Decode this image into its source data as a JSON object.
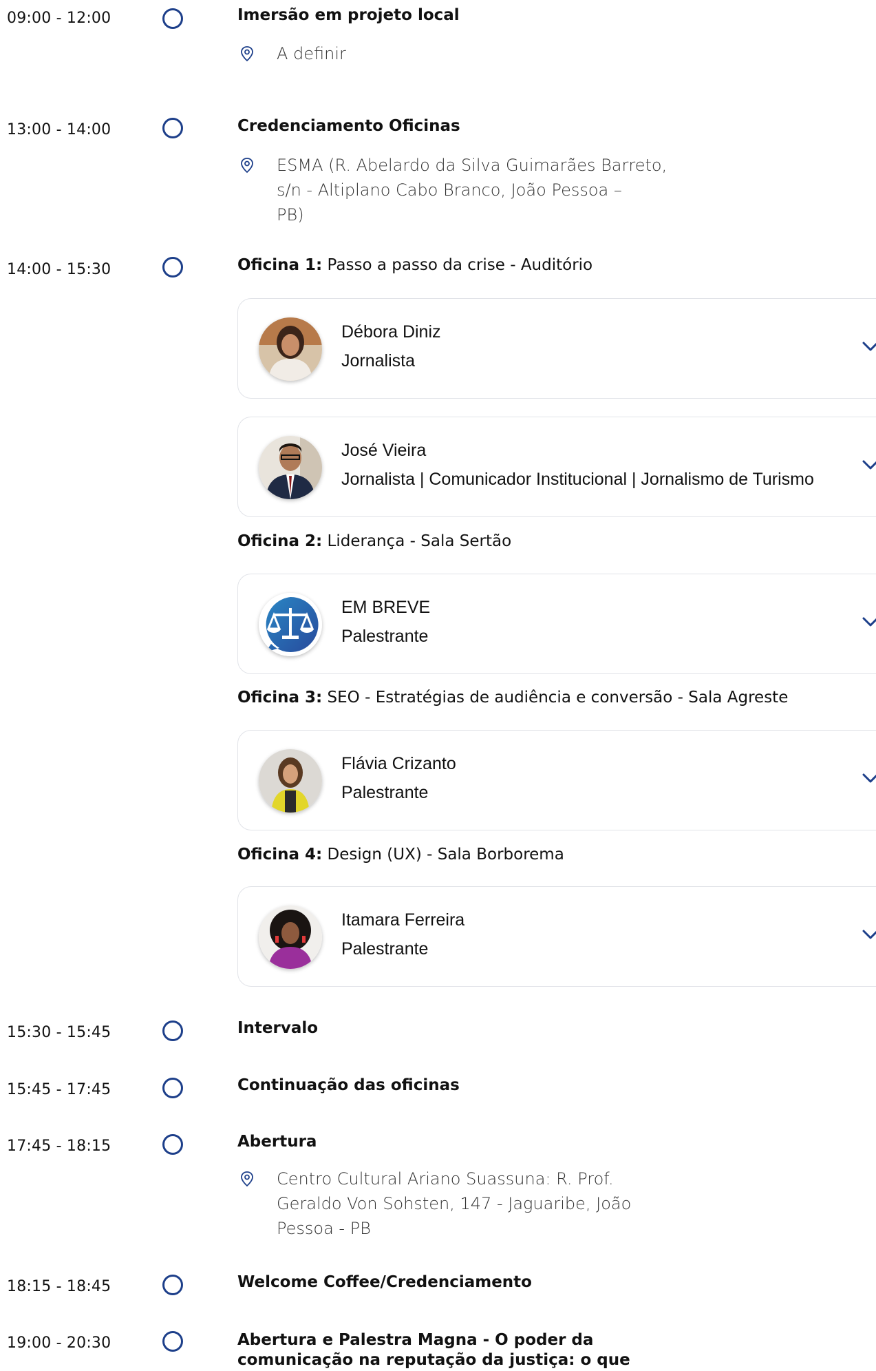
{
  "colors": {
    "accent": "#1d3f8a"
  },
  "schedule": [
    {
      "time": "09:00 - 12:00",
      "title": "Imersão em projeto local",
      "location": "A definir"
    },
    {
      "time": "13:00 - 14:00",
      "title": "Credenciamento Oficinas",
      "location_lines": [
        "ESMA (R. Abelardo da Silva Guimarães Barreto,",
        "s/n - Altiplano Cabo Branco, João Pessoa –",
        "PB)"
      ]
    },
    {
      "time": "14:00 - 15:30"
    },
    {
      "time": "15:30 - 15:45",
      "title": "Intervalo"
    },
    {
      "time": "15:45 - 17:45",
      "title": "Continuação das oficinas"
    },
    {
      "time": "17:45 - 18:15",
      "title": "Abertura",
      "location_lines": [
        "Centro Cultural Ariano Suassuna: R. Prof.",
        "Geraldo Von Sohsten, 147 - Jaguaribe, João",
        "Pessoa - PB"
      ]
    },
    {
      "time": "18:15 - 18:45",
      "title": "Welcome Coffee/Credenciamento"
    },
    {
      "time": "19:00 - 20:30",
      "title_lines": [
        "Abertura e Palestra Magna - O poder da",
        "comunicação na reputação da justiça: o que"
      ]
    }
  ],
  "workshops": [
    {
      "label": "Oficina 1:",
      "text": " Passo a passo da crise - Auditório"
    },
    {
      "label": "Oficina 2:",
      "text": " Liderança - Sala Sertão"
    },
    {
      "label": "Oficina 3:",
      "text": " SEO - Estratégias de audiência e conversão - Sala Agreste"
    },
    {
      "label": "Oficina 4:",
      "text": " Design (UX) - Sala Borborema"
    }
  ],
  "speakers": [
    {
      "name": "Débora Diniz",
      "role": "Jornalista",
      "avatar": "photo-avatar"
    },
    {
      "name": "José Vieira",
      "role": "Jornalista | Comunicador Institucional | Jornalismo de Turismo",
      "avatar": "photo-avatar"
    },
    {
      "name": "EM BREVE",
      "role": "Palestrante",
      "avatar": "scales-of-justice-logo"
    },
    {
      "name": "Flávia Crizanto",
      "role": "Palestrante",
      "avatar": "photo-avatar"
    },
    {
      "name": "Itamara Ferreira",
      "role": "Palestrante",
      "avatar": "photo-avatar"
    }
  ]
}
